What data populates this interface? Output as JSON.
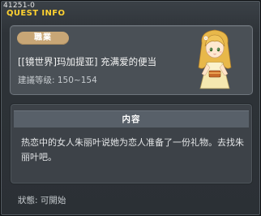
{
  "window": {
    "quest_id": "41251-0",
    "title": "QUEST INFO"
  },
  "info": {
    "job_label": "職業",
    "quest_name": "[[镜世界]玛加提亚] 充满爱的便当",
    "level_requirement": "建議等级: 150~154"
  },
  "content": {
    "header": "内容",
    "text": "热恋中的女人朱丽叶说她为恋人准备了一份礼物。去找朱丽叶吧。"
  },
  "status": {
    "text": "狀態:  可開始"
  },
  "colors": {
    "title": "#ffd230",
    "job_badge": "#c8a676",
    "panel": "#4a5056"
  },
  "icons": {
    "npc": "juliet-npc-portrait"
  }
}
